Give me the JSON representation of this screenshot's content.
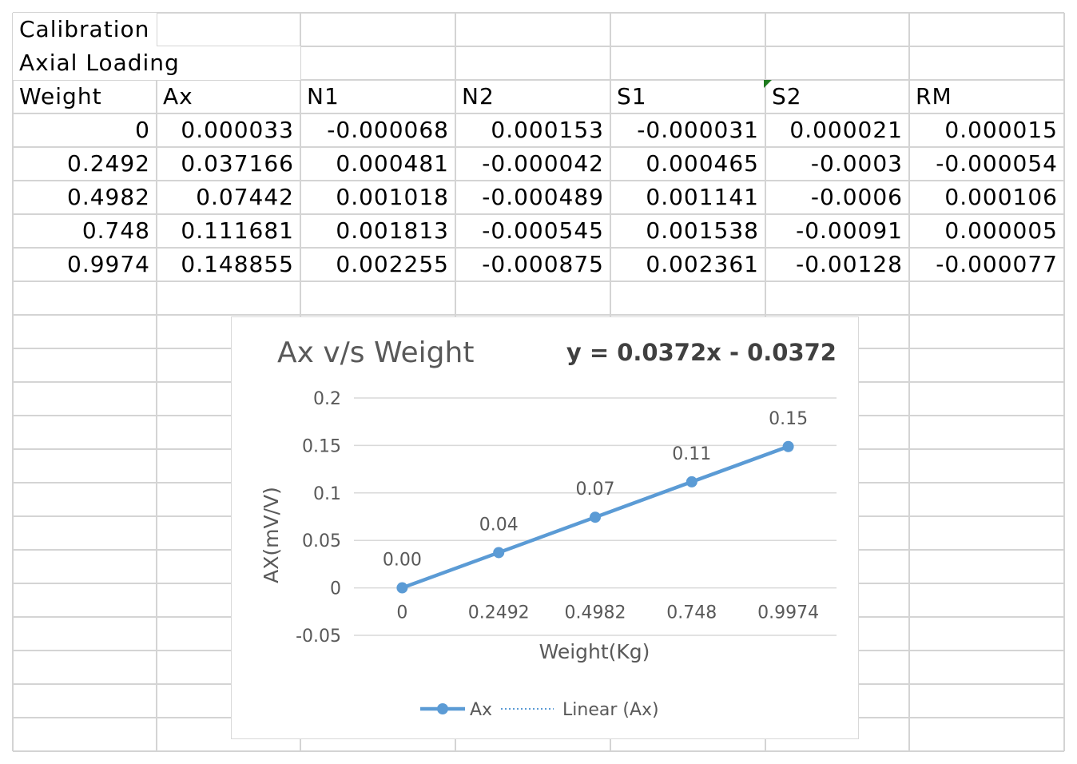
{
  "sheet": {
    "title_cell": "Calibration",
    "subtitle_cell": "Axial Loading",
    "headers": [
      "Weight",
      "Ax",
      "N1",
      "N2",
      "S1",
      "S2",
      "RM"
    ],
    "rows": [
      [
        "0",
        "0.000033",
        "-0.000068",
        "0.000153",
        "-0.000031",
        "0.000021",
        "0.000015"
      ],
      [
        "0.2492",
        "0.037166",
        "0.000481",
        "-0.000042",
        "0.000465",
        "-0.0003",
        "-0.000054"
      ],
      [
        "0.4982",
        "0.07442",
        "0.001018",
        "-0.000489",
        "0.001141",
        "-0.0006",
        "0.000106"
      ],
      [
        "0.748",
        "0.111681",
        "0.001813",
        "-0.000545",
        "0.001538",
        "-0.00091",
        "0.000005"
      ],
      [
        "0.9974",
        "0.148855",
        "0.002255",
        "-0.000875",
        "0.002361",
        "-0.00128",
        "-0.000077"
      ]
    ],
    "gridline_color": "#d4d4d4",
    "selection_marker_color": "#1e7a1e"
  },
  "chart_data": {
    "type": "line",
    "title": "Ax v/s Weight",
    "trendline_equation": "y = 0.0372x - 0.0372",
    "xlabel": "Weight(Kg)",
    "ylabel": "AX(mV/V)",
    "categories": [
      "0",
      "0.2492",
      "0.4982",
      "0.748",
      "0.9974"
    ],
    "series": [
      {
        "name": "Ax",
        "values": [
          3.3e-05,
          0.037166,
          0.07442,
          0.111681,
          0.148855
        ],
        "data_labels": [
          "0.00",
          "0.04",
          "0.07",
          "0.11",
          "0.15"
        ],
        "color": "#5b9bd5"
      }
    ],
    "trendline": {
      "name": "Linear (Ax)",
      "style": "dotted",
      "color": "#5b9bd5"
    },
    "yticks": [
      "0.2",
      "0.15",
      "0.1",
      "0.05",
      "0",
      "-0.05"
    ],
    "ylim": [
      -0.05,
      0.2
    ],
    "grid": true,
    "legend": "bottom",
    "text_color": "#595959",
    "gridline_color": "#d9d9d9"
  }
}
